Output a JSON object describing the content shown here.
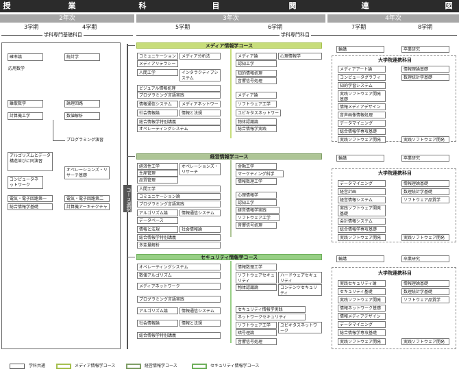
{
  "title_chars": [
    "授",
    "業",
    "科",
    "目",
    "関",
    "連",
    "図"
  ],
  "years": [
    "2年次",
    "3年次",
    "4年次"
  ],
  "semesters": [
    "3学期",
    "4学期",
    "5学期",
    "6学期",
    "7学期",
    "8学期"
  ],
  "categories": {
    "basic": "学科専門基礎科目",
    "specialized": "学科専門科目"
  },
  "course_selection_label": "コース選択",
  "left": {
    "col3": [
      "確率論",
      "応用数学",
      "離散数学",
      "計算機工学",
      "アルゴリズムとデータ構造並びに同演習",
      "コンピュータネットワーク",
      "電気・電子回路第一",
      "総合情報学基礎"
    ],
    "col4": [
      "統計学",
      "論理回路",
      "数値解析",
      "プログラミング演習",
      "オペレーションズ・リサーチ基礎",
      "電気・電子回路第二",
      "計算機アーキテクチャー"
    ]
  },
  "media": {
    "title": "メディア情報学コース",
    "s5": [
      "コミュニケーション論",
      "メディア分析法",
      "メディアリテラシー",
      "人間工学",
      "インタラクティブシステム",
      "ビジュアル情報処理",
      "プログラミング言語実践",
      "情報通信システム",
      "メディアネットワーク",
      "社会情報論",
      "情報と法規",
      "総合情報学特別講義",
      "オペレーティングシステム"
    ],
    "s6": [
      "メディア論",
      "心理情報学",
      "認知工学",
      "知的情報処理",
      "音響信号処理",
      "メディア論",
      "ソフトウェア工学",
      "ユビキタスネットワーク",
      "物体認識論",
      "総合情報学実践"
    ],
    "s7": [
      "輪講",
      "メディアアート論",
      "コンピュータグラフィックス",
      "知的学習システム",
      "実践ソフトウェア開発基礎",
      "情報メディアデザイン",
      "音声画像情報処理",
      "データマイニング",
      "総合情報学専攻基礎",
      "実践ソフトウェア開発総論"
    ],
    "s8": [
      "卒業研究",
      "情報理論基礎",
      "数理統計学基礎",
      "実践ソフトウェア開発総論"
    ],
    "grad_title": "大学院連携科目"
  },
  "business": {
    "title": "経営情報学コース",
    "s5": [
      "経済性工学",
      "オペレーションズ・リサーチ",
      "生産管理",
      "品質管理",
      "人間工学",
      "コミュニケーション論",
      "プログラミング言語実践",
      "アルゴリズム論",
      "情報通信システム",
      "データベース",
      "情報と法規",
      "社会情報論",
      "総合情報学特別講義",
      "多変量解析"
    ],
    "s6": [
      "金融工学",
      "マーケティング科学",
      "情報数理工学",
      "心理情報学",
      "認知工学",
      "経営情報学実践",
      "ソフトウェア工学",
      "音響信号処理"
    ],
    "s7": [
      "輪講",
      "データマイニング",
      "経営計画",
      "経営情報システム",
      "実践ソフトウェア開発基礎",
      "会計情報システム",
      "総合情報学専攻基礎",
      "実践ソフトウェア開発総論"
    ],
    "s8": [
      "卒業研究",
      "情報理論基礎",
      "数理統計学基礎",
      "ソフトウェア品質学",
      "実践ソフトウェア開発総論"
    ],
    "grad_title": "大学院連携科目"
  },
  "security": {
    "title": "セキュリティ情報学コース",
    "s5": [
      "オペレーティングシステム",
      "数値アルゴリズム",
      "メディアネットワーク",
      "プログラミング言語実践",
      "アルゴリズム論",
      "情報通信システム",
      "社会情報論",
      "情報と法規",
      "総合情報学特別講義"
    ],
    "s6": [
      "情報数理工学",
      "ソフトウェアセキュリティ",
      "ハードウェアセキュリティ",
      "物体認識論",
      "コンテンツセキュリティ",
      "セキュリティ情報学実践",
      "ネットワークセキュリティ",
      "ソフトウェア工学",
      "ユビキタスネットワーク",
      "暗号理論",
      "音響信号処理"
    ],
    "s7": [
      "輪講",
      "実践セキュリティ論",
      "セキュリティ基礎",
      "実践ソフトウェア開発基礎",
      "情報ネットワーク基礎",
      "情報メディアデザイン",
      "データマイニング",
      "総合情報学専攻基礎",
      "実践ソフトウェア開発総論"
    ],
    "s8": [
      "卒業研究",
      "情報理論基礎",
      "数理統計学基礎",
      "ソフトウェア品質学",
      "実践ソフトウェア開発総論"
    ],
    "grad_title": "大学院連携科目"
  },
  "legend": [
    "学科共通",
    "メディア情報学コース",
    "経営情報学コース",
    "セキュリティ情報学コース"
  ],
  "colors": {
    "media": "#c7dd7a",
    "business": "#aec596",
    "security": "#97cf85",
    "header": "#2b2b2b",
    "year": "#a7a7a7"
  }
}
